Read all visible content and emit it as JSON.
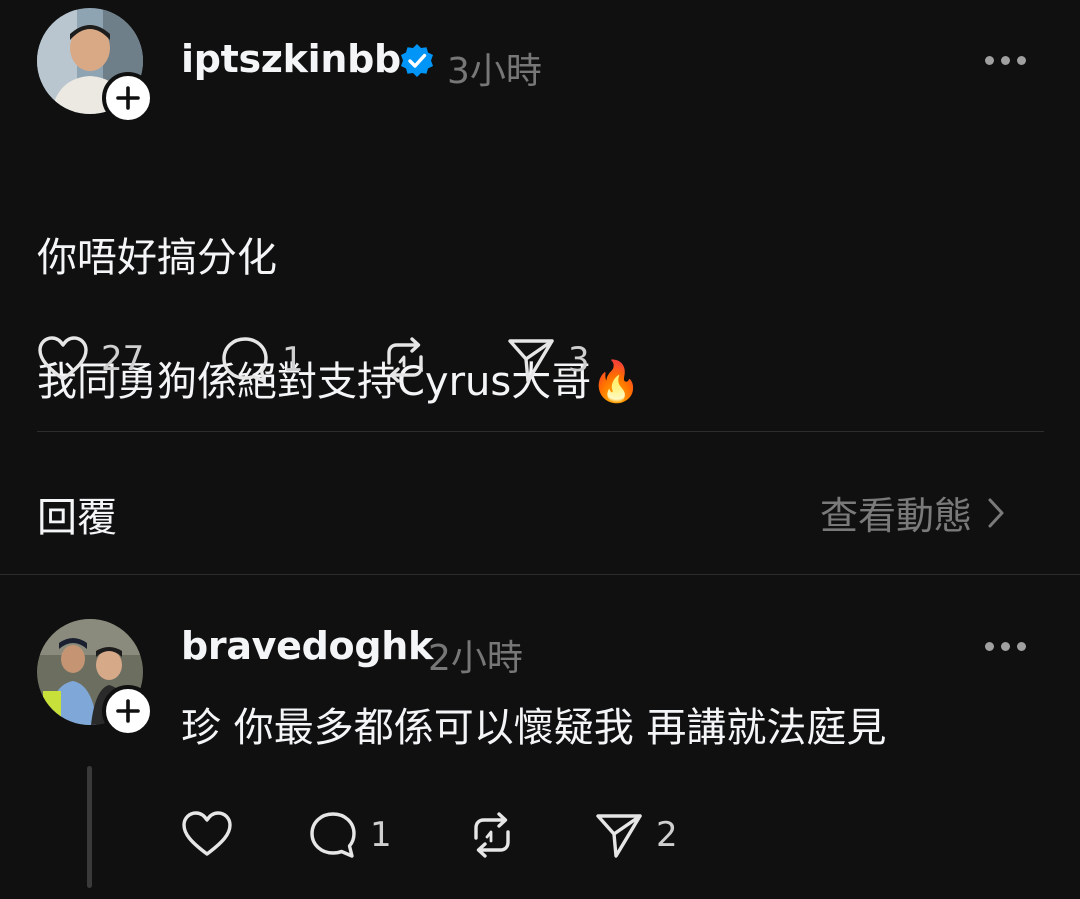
{
  "post": {
    "username": "iptszkinbb",
    "verified": true,
    "timestamp": "3小時",
    "text_line1": "你唔好搞分化",
    "text_line2": "我同勇狗係絕對支持Cyrus大哥🔥",
    "likes": "27",
    "comments": "1",
    "reposts": "",
    "shares": "3"
  },
  "replies_section": {
    "label": "回覆",
    "view_activity": "查看動態"
  },
  "reply": {
    "username": "bravedoghk",
    "timestamp": "2小時",
    "text": "珍 你最多都係可以懷疑我 再講就法庭見",
    "likes": "",
    "comments": "1",
    "reposts": "",
    "shares": "2"
  },
  "colors": {
    "background": "#101010",
    "verified_blue": "#0095f6",
    "secondary_text": "#777777"
  }
}
